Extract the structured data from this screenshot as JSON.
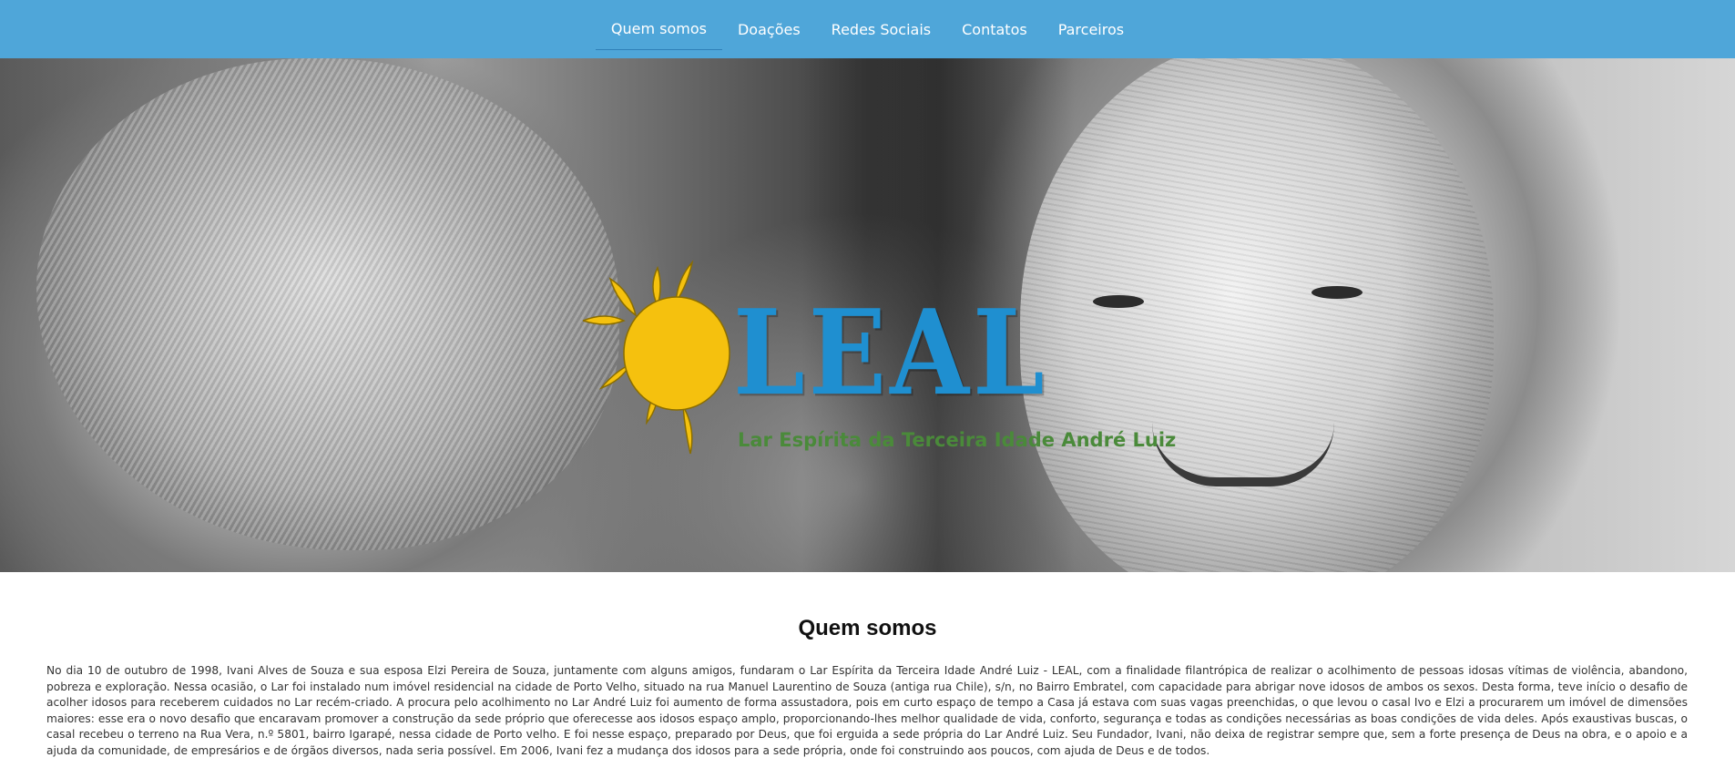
{
  "nav": {
    "items": [
      {
        "label": "Quem somos",
        "active": true
      },
      {
        "label": "Doações"
      },
      {
        "label": "Redes Sociais"
      },
      {
        "label": "Contatos"
      },
      {
        "label": "Parceiros"
      }
    ]
  },
  "hero": {
    "logo": {
      "word": "LEAL",
      "subtitle": "Lar Espírita da Terceira Idade André Luiz",
      "colors": {
        "sun": "#f5c10e",
        "word": "#1f8fd0",
        "subtitle": "#4a8a3a"
      }
    }
  },
  "about": {
    "title": "Quem somos",
    "body": "No dia 10 de outubro de 1998, Ivani Alves de Souza e sua esposa Elzi Pereira de Souza, juntamente com alguns amigos, fundaram o Lar Espírita da Terceira Idade André Luiz - LEAL, com a finalidade filantrópica de realizar o acolhimento de pessoas idosas vítimas de violência, abandono, pobreza e exploração. Nessa ocasião, o Lar foi instalado num imóvel residencial na cidade de Porto Velho, situado na rua Manuel Laurentino de Souza (antiga rua Chile), s/n, no Bairro Embratel, com capacidade para abrigar nove idosos de ambos os sexos. Desta forma, teve início o desafio de acolher idosos para receberem cuidados no Lar recém-criado. A procura pelo acolhimento no Lar André Luiz foi aumento de forma assustadora, pois em curto espaço de tempo a Casa já estava com suas vagas preenchidas, o que levou o casal Ivo e Elzi a procurarem um imóvel de dimensões maiores: esse era o novo desafio que encaravam promover a construção da sede próprio que oferecesse aos idosos espaço amplo, proporcionando-lhes melhor qualidade de vida, conforto, segurança e todas as condições necessárias as boas condições de vida deles. Após exaustivas buscas, o casal recebeu o terreno na Rua Vera, n.º 5801, bairro Igarapé, nessa cidade de Porto velho. E foi nesse espaço, preparado por Deus, que foi erguida a sede própria do Lar André Luiz. Seu Fundador, Ivani, não deixa de registrar sempre que, sem a forte presença de Deus na obra, e o apoio e a ajuda da comunidade, de empresários e de órgãos diversos, nada seria possível. Em 2006, Ivani fez a mudança dos idosos para a sede própria, onde foi construindo aos poucos, com ajuda de Deus e de todos."
  },
  "theme": {
    "navbar": "#4fa6d9",
    "nav_text": "#ffffff"
  }
}
